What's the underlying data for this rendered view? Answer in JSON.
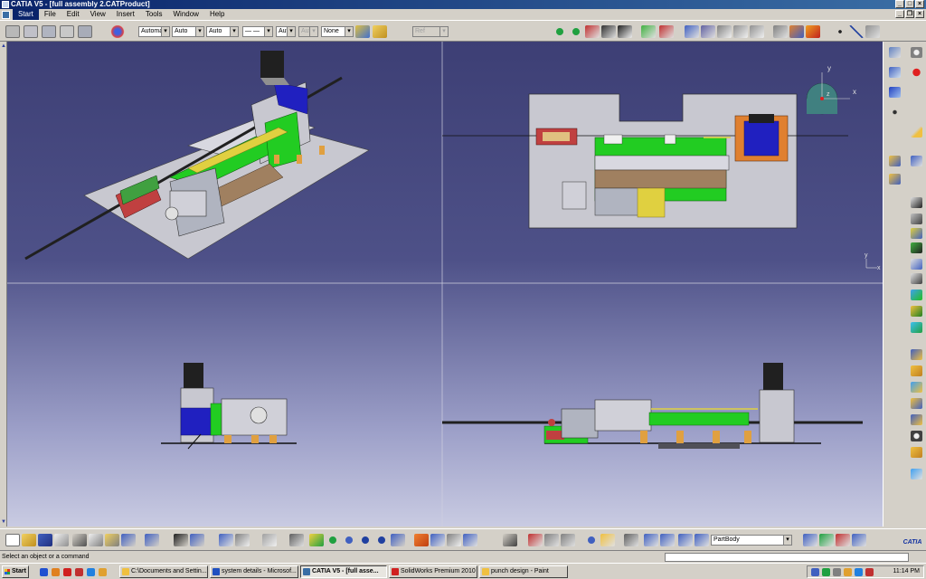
{
  "window": {
    "title": "CATIA V5 - [full assembly 2.CATProduct]"
  },
  "menu": {
    "items": [
      "Start",
      "File",
      "Edit",
      "View",
      "Insert",
      "Tools",
      "Window",
      "Help"
    ]
  },
  "toolbar_top": {
    "combos": [
      "Automa",
      "Auto",
      "Auto",
      "— —",
      "Aut",
      "Aut",
      "None",
      "Ref"
    ]
  },
  "viewport": {
    "axis_x": "x",
    "axis_y": "y",
    "axis_z": "z"
  },
  "toolbar_bottom": {
    "part_combo": "PartBody"
  },
  "status": {
    "message": "Select an object or a command"
  },
  "taskbar": {
    "start_label": "Start",
    "tasks": [
      "C:\\Documents and Settin...",
      "system details - Microsof...",
      "CATIA V5 - [full asse...",
      "SolidWorks Premium 2010",
      "punch design - Paint"
    ],
    "clock": "11:14 PM"
  },
  "logo": {
    "text": "CATIA"
  },
  "colors": {
    "title_bar": "#0a246a",
    "viewport_top": "#3d3f75",
    "viewport_bottom": "#c9cbe2",
    "part_green": "#22cc22",
    "part_blue": "#2020c0",
    "part_gray": "#c8c8d0"
  }
}
